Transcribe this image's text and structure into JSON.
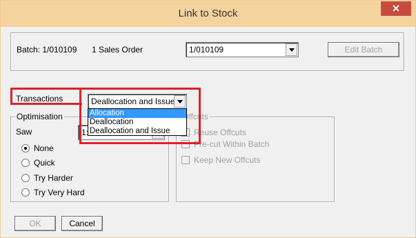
{
  "window": {
    "title": "Link to Stock",
    "close_glyph": "✕"
  },
  "batch": {
    "label": "Batch: 1/010109",
    "sales_order": "1 Sales Order",
    "selected_batch": "1/010109",
    "edit_button": "Edit Batch"
  },
  "transactions": {
    "label": "Transactions",
    "selected": "Deallocation and Issue",
    "options": [
      "Allocation",
      "Deallocation",
      "Deallocation and Issue"
    ],
    "highlighted_option": "Allocation"
  },
  "optimisation": {
    "title": "Optimisation",
    "saw_label": "Saw",
    "saw_value": "1:",
    "options": [
      "None",
      "Quick",
      "Try Harder",
      "Try Very Hard"
    ],
    "selected": "None"
  },
  "offcuts": {
    "title": "Offcuts",
    "options": [
      "Reuse Offcuts",
      "Pre-cut Within Batch",
      "Keep New Offcuts"
    ]
  },
  "footer": {
    "ok": "OK",
    "cancel": "Cancel"
  },
  "colors": {
    "titlebar": "#f5d39e",
    "close": "#c74b3f",
    "highlight": "#e0202a",
    "selection": "#3399ff"
  }
}
